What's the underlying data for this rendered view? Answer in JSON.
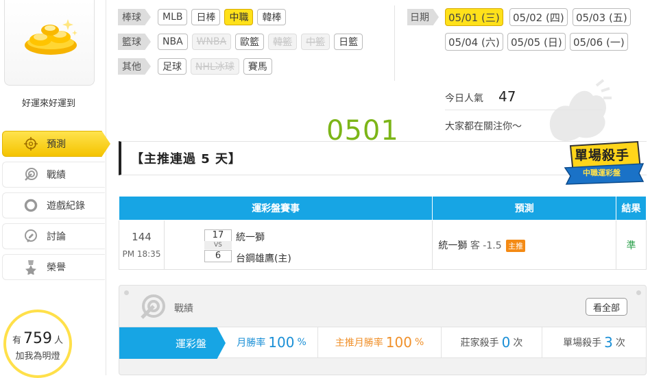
{
  "sidebar": {
    "username": "好運來好運到",
    "nav": [
      {
        "label": "預測",
        "icon": "crosshair-icon",
        "active": true
      },
      {
        "label": "戰績",
        "icon": "target-icon",
        "active": false
      },
      {
        "label": "遊戲紀錄",
        "icon": "record-ring-icon",
        "active": false
      },
      {
        "label": "討論",
        "icon": "chat-icon",
        "active": false
      },
      {
        "label": "榮譽",
        "icon": "medal-icon",
        "active": false
      }
    ],
    "fans": {
      "prefix": "有",
      "count": "759",
      "suffix": "人",
      "line2": "加我為明燈"
    }
  },
  "filters": {
    "baseball": {
      "label": "棒球",
      "items": [
        "MLB",
        "日棒",
        "中職",
        "韓棒"
      ]
    },
    "basketball": {
      "label": "籃球",
      "items": [
        "NBA",
        "WNBA",
        "歐籃",
        "韓籃",
        "中籃",
        "日籃"
      ]
    },
    "other": {
      "label": "其他",
      "items": [
        "足球",
        "NHL冰球",
        "賽馬"
      ]
    }
  },
  "dates": {
    "label": "日期",
    "items": [
      "05/01 (三)",
      "05/02 (四)",
      "05/03 (五)",
      "05/04 (六)",
      "05/05 (日)",
      "05/06 (一)"
    ]
  },
  "popularity": {
    "label": "今日人氣",
    "count": "47",
    "subtitle": "大家都在關注你～"
  },
  "current_date": "0501",
  "headline": "【主推連過 5 天】",
  "badge": {
    "line1": "單場殺手",
    "line2": "中職運彩盤"
  },
  "table": {
    "headers": [
      "運彩盤賽事",
      "預測",
      "結果"
    ],
    "row": {
      "game_no": "144",
      "time": "PM 18:35",
      "away_score": "17",
      "vs": "VS",
      "home_score": "6",
      "away_team": "統一獅",
      "home_team": "台鋼雄鷹(主)",
      "prediction": "統一獅",
      "side": "客",
      "handicap": "-1.5",
      "main_tag": "主推",
      "result": "準"
    }
  },
  "record": {
    "title": "戰績",
    "see_all": "看全部",
    "type": "運彩盤",
    "stats": [
      {
        "label": "月勝率",
        "value": "100",
        "unit": "%"
      },
      {
        "label": "主推月勝率",
        "value": "100",
        "unit": "%"
      },
      {
        "label": "莊家殺手",
        "value": "0",
        "unit": "次"
      },
      {
        "label": "單場殺手",
        "value": "3",
        "unit": "次"
      }
    ]
  }
}
